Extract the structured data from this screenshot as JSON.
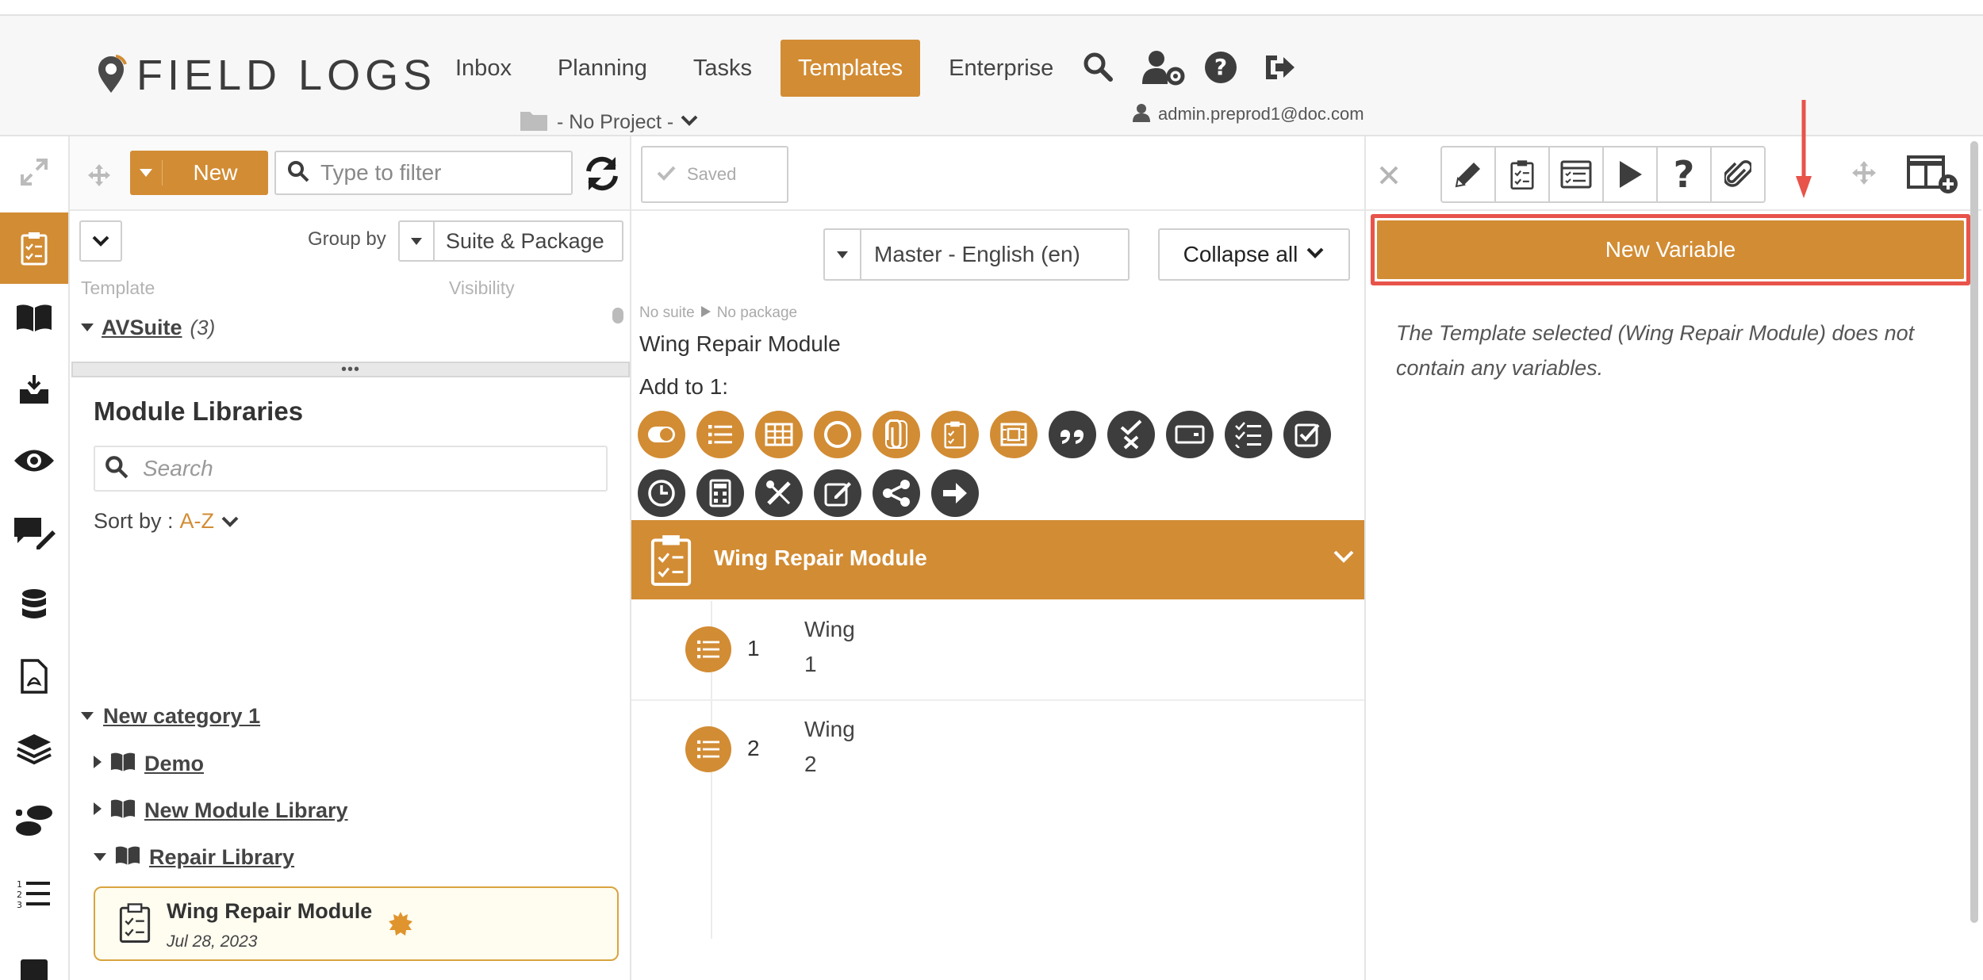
{
  "app": {
    "logo_text": "FIELD LOGS"
  },
  "nav": {
    "items": [
      {
        "label": "Inbox"
      },
      {
        "label": "Planning"
      },
      {
        "label": "Tasks"
      },
      {
        "label": "Templates",
        "active": true
      },
      {
        "label": "Enterprise"
      }
    ],
    "project": "- No Project -",
    "user": "admin.preprod1@doc.com"
  },
  "template_panel": {
    "new_label": "New",
    "filter_placeholder": "Type to filter",
    "group_by_label": "Group by",
    "group_by_value": "Suite & Package",
    "col_template": "Template",
    "col_visibility": "Visibility",
    "suite_name": "AVSuite",
    "suite_count": "(3)",
    "libraries_title": "Module Libraries",
    "search_placeholder": "Search",
    "sort_label": "Sort by :",
    "sort_value": "A-Z",
    "category": "New category 1",
    "libraries": [
      {
        "name": "Demo"
      },
      {
        "name": "New Module Library"
      },
      {
        "name": "Repair Library"
      }
    ],
    "module": {
      "name": "Wing Repair Module",
      "date": "Jul 28, 2023"
    }
  },
  "center": {
    "saved_label": "Saved",
    "language": "Master - English (en)",
    "collapse_label": "Collapse all",
    "breadcrumb_suite": "No suite",
    "breadcrumb_package": "No package",
    "module_title": "Wing Repair Module",
    "add_to_label": "Add to 1:",
    "section_title": "Wing Repair Module",
    "steps": [
      {
        "num": "1",
        "line1": "Wing",
        "line2": "1"
      },
      {
        "num": "2",
        "line1": "Wing",
        "line2": "2"
      }
    ]
  },
  "right": {
    "new_variable_label": "New Variable",
    "empty_message": "The Template selected (Wing Repair Module) does not contain any variables."
  },
  "colors": {
    "accent": "#d28c34",
    "highlight": "#e8534a",
    "dark_icon": "#3d3d3d"
  }
}
